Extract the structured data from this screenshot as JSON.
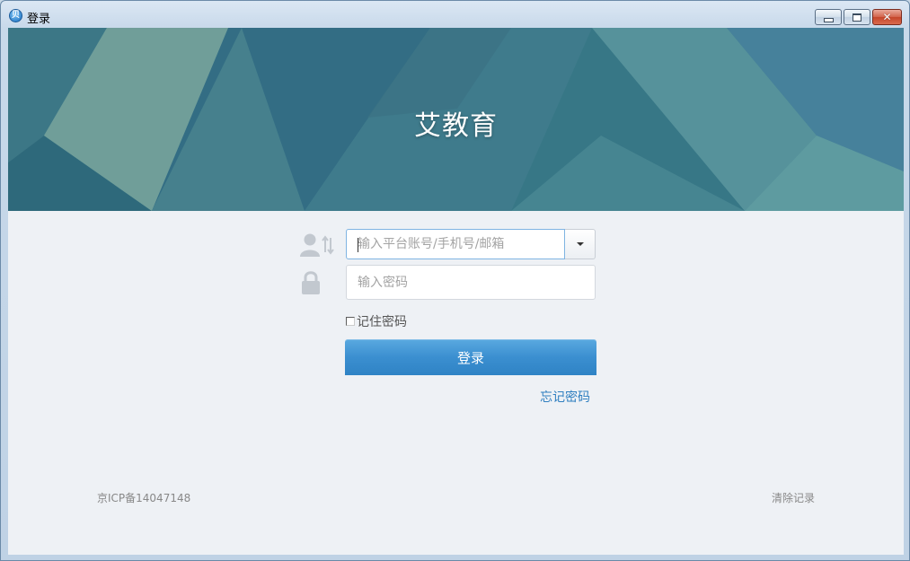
{
  "window": {
    "title": "登录",
    "app_icon_glyph": "贝",
    "controls": {
      "minimize": "minimize-icon",
      "maximize": "maximize-icon",
      "close": "close-icon",
      "close_glyph": "✕"
    }
  },
  "banner": {
    "brand": "艾教育"
  },
  "form": {
    "account_placeholder": "输入平台账号/手机号/邮箱",
    "account_value": "",
    "password_placeholder": "输入密码",
    "password_value": "",
    "remember_label": "记住密码",
    "remember_checked": false,
    "login_label": "登录",
    "forgot_label": "忘记密码"
  },
  "footer": {
    "icp": "京ICP备14047148",
    "clear_records": "清除记录"
  },
  "colors": {
    "accent": "#3b8fd0",
    "link": "#2f7fc0",
    "banner_base": "#4f8a96"
  }
}
